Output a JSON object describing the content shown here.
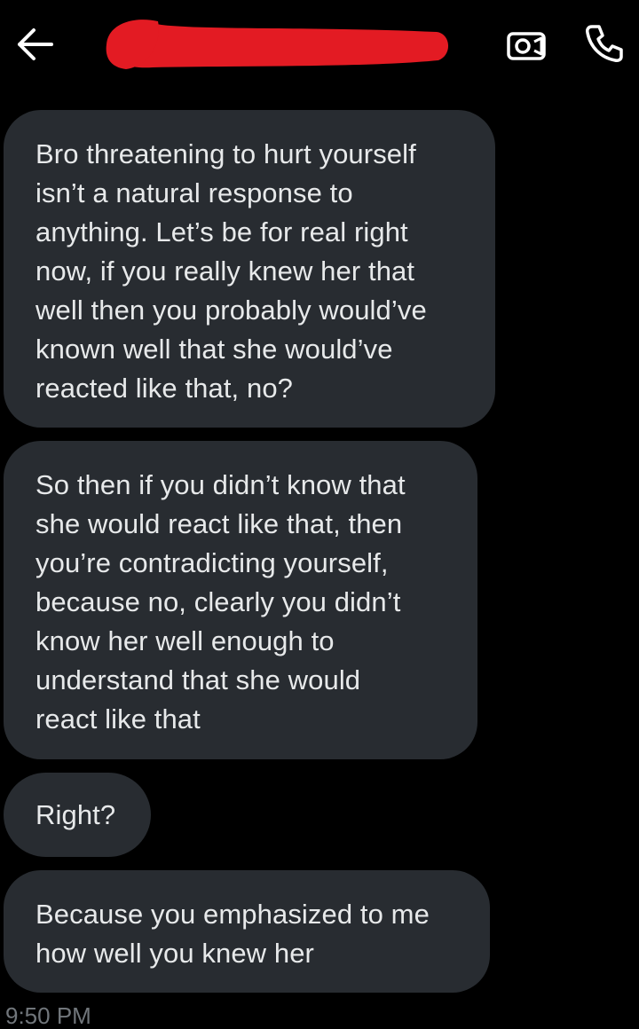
{
  "header": {
    "back_icon": "arrow-left-icon",
    "contact_name": "",
    "redaction_color": "#e31b23",
    "video_icon": "video-call-icon",
    "phone_icon": "phone-call-icon"
  },
  "messages": [
    {
      "text": "Bro threatening to hurt yourself\nisn’t a natural response to\nanything. Let’s be for real right\nnow, if you really knew her that\nwell then you probably would’ve\nknown well that she would’ve\nreacted like that, no?"
    },
    {
      "text": "So then if you didn’t know that\nshe would react like that, then\nyou’re contradicting yourself,\nbecause no, clearly you didn’t\nknow her well enough to\nunderstand that she would\nreact like that"
    },
    {
      "text": "Right?"
    },
    {
      "text": "Because you emphasized to me\nhow well you knew her"
    }
  ],
  "timestamp": "9:50 PM",
  "colors": {
    "background": "#000000",
    "bubble": "#282c31",
    "text": "#e7e9ea",
    "muted": "#71767b"
  }
}
